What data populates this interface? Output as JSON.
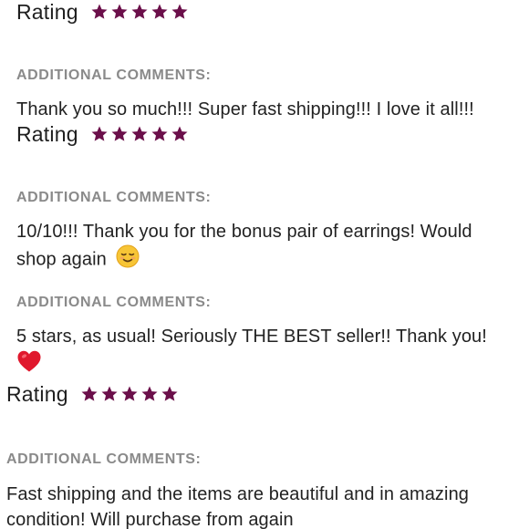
{
  "reviews": [
    {
      "rating_label": "Rating",
      "stars": 5,
      "comments_label": "ADDITIONAL COMMENTS:",
      "comment": "Thank you so much!!! Super fast shipping!!! I love it all!!!"
    },
    {
      "rating_label": "Rating",
      "stars": 5,
      "comments_label": "ADDITIONAL COMMENTS:",
      "comment_line1": "10/10!!! Thank you for the bonus pair of earrings! Would",
      "comment_line2": "shop again",
      "emoji": "smiling-face-icon"
    },
    {
      "comments_label": "ADDITIONAL COMMENTS:",
      "comment": "5 stars, as usual! Seriously THE BEST seller!! Thank you!",
      "emoji": "red-heart-icon"
    },
    {
      "rating_label": "Rating",
      "stars": 5,
      "comments_label": "ADDITIONAL COMMENTS:",
      "comment_line1": "Fast shipping and the items are beautiful and in amazing",
      "comment_line2": "condition! Will purchase from again"
    }
  ],
  "colors": {
    "star": "#6b0f4a",
    "label_gray": "#8a8a8a",
    "text": "#222222"
  }
}
